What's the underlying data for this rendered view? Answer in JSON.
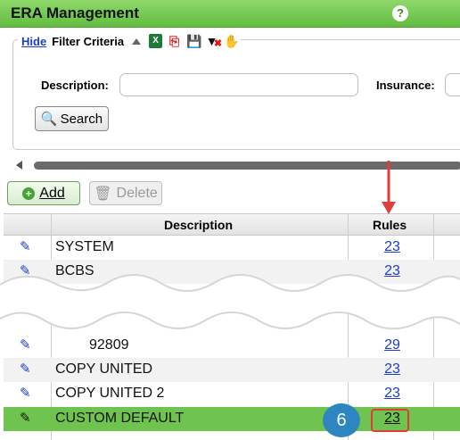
{
  "window": {
    "title": "ERA Management",
    "help_icon": "?"
  },
  "filter": {
    "hide_label": "Hide",
    "title": "Filter Criteria",
    "icons": [
      "collapse-icon",
      "excel-icon",
      "pdf-icon",
      "save-icon",
      "clear-filter-icon",
      "hand-icon"
    ],
    "description_label": "Description:",
    "description_value": "",
    "insurance_label": "Insurance:",
    "insurance_value": "",
    "search_label": "Search"
  },
  "toolbar": {
    "add_label": "Add",
    "delete_label": "Delete"
  },
  "grid": {
    "columns": {
      "description": "Description",
      "rules": "Rules"
    },
    "rows": [
      {
        "description": "SYSTEM",
        "rules": "23"
      },
      {
        "description": "BCBS",
        "rules": "23"
      },
      {
        "description": "92809",
        "rules": "29"
      },
      {
        "description": "COPY UNITED",
        "rules": "23"
      },
      {
        "description": "COPY UNITED 2",
        "rules": "23"
      },
      {
        "description": "CUSTOM DEFAULT",
        "rules": "23",
        "selected": true
      }
    ]
  },
  "annotation": {
    "step_number": "6"
  },
  "colors": {
    "accent": "#6ec44f",
    "link": "#1a3ec9",
    "callout": "#2e86c1",
    "highlight": "#e03c3c"
  }
}
